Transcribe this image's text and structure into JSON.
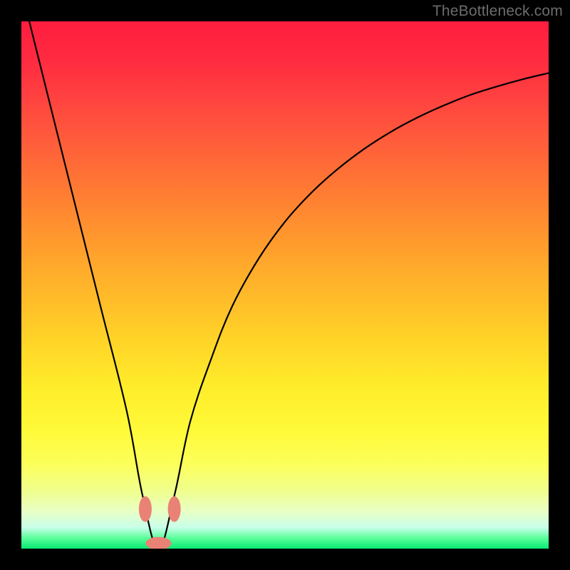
{
  "watermark": "TheBottleneck.com",
  "chart_data": {
    "type": "line",
    "title": "",
    "xlabel": "",
    "ylabel": "",
    "xlim": [
      0,
      100
    ],
    "ylim": [
      0,
      100
    ],
    "grid": false,
    "legend": false,
    "notes": "V-shaped bottleneck curve over vertical red→green gradient; minimum near x≈26; no axis ticks or labels rendered.",
    "series": [
      {
        "name": "bottleneck-curve",
        "x": [
          0,
          5,
          10,
          15,
          20,
          23,
          26,
          29,
          32,
          36,
          40,
          45,
          50,
          55,
          60,
          65,
          70,
          75,
          80,
          85,
          90,
          95,
          100
        ],
        "values": [
          106,
          86,
          66,
          46,
          26,
          10,
          0,
          10,
          24,
          36,
          46,
          55,
          62,
          67.5,
          72,
          75.8,
          79,
          81.7,
          84,
          86,
          87.6,
          89,
          90.2
        ]
      }
    ],
    "markers": [
      {
        "name": "blob-left",
        "x": 23.5,
        "y": 7.5
      },
      {
        "name": "blob-right",
        "x": 29.0,
        "y": 7.5
      },
      {
        "name": "blob-bottom",
        "x": 26.0,
        "y": 1.0
      }
    ]
  }
}
